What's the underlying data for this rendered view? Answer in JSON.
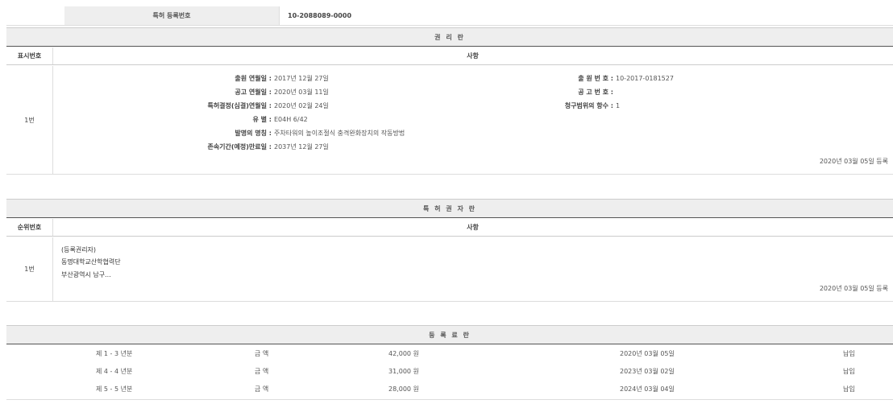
{
  "registration": {
    "label": "특허 등록번호",
    "value": "10-2088089-0000"
  },
  "rights_section": {
    "title": "권 리 란",
    "col_number": "표시번호",
    "col_content": "사항",
    "row_number": "1번",
    "left_fields": [
      {
        "label": "출원 연월일 :",
        "value": "2017년 12월 27일"
      },
      {
        "label": "공고 연월일 :",
        "value": "2020년 03월 11일"
      },
      {
        "label": "특허결정(심결)연월일 :",
        "value": "2020년 02월 24일"
      },
      {
        "label": "유 별 :",
        "value": "E04H 6/42"
      },
      {
        "label": "발명의 명칭 :",
        "value": "주차타워의 높이조절식 충격완화장치의 작동방법"
      },
      {
        "label": "존속기간(예정)만료일 :",
        "value": "2037년 12월 27일"
      }
    ],
    "right_fields": [
      {
        "label": "출 원 번 호 :",
        "value": "10-2017-0181527"
      },
      {
        "label": "공 고 번 호 :",
        "value": ""
      },
      {
        "label": "청구범위의 항수 :",
        "value": "1"
      }
    ],
    "registered_date": "2020년 03월 05일 등록"
  },
  "patentee_section": {
    "title": "특 허 권 자 란",
    "col_number": "순위번호",
    "col_content": "사항",
    "row_number": "1번",
    "lines": [
      "(등록권리자)",
      "동명대학교산학협력단",
      "부산광역시 남구..."
    ],
    "registered_date": "2020년 03월 05일 등록"
  },
  "fee_section": {
    "title": "등 록 료 란",
    "rows": [
      {
        "period": "제 1 - 3 년분",
        "amount_label": "금 액",
        "amount": "42,000 원",
        "date": "2020년 03월 05일",
        "status": "납입"
      },
      {
        "period": "제 4 - 4 년분",
        "amount_label": "금 액",
        "amount": "31,000 원",
        "date": "2023년 03월 02일",
        "status": "납입"
      },
      {
        "period": "제 5 - 5 년분",
        "amount_label": "금 액",
        "amount": "28,000 원",
        "date": "2024년 03월 04일",
        "status": "납입"
      }
    ]
  }
}
